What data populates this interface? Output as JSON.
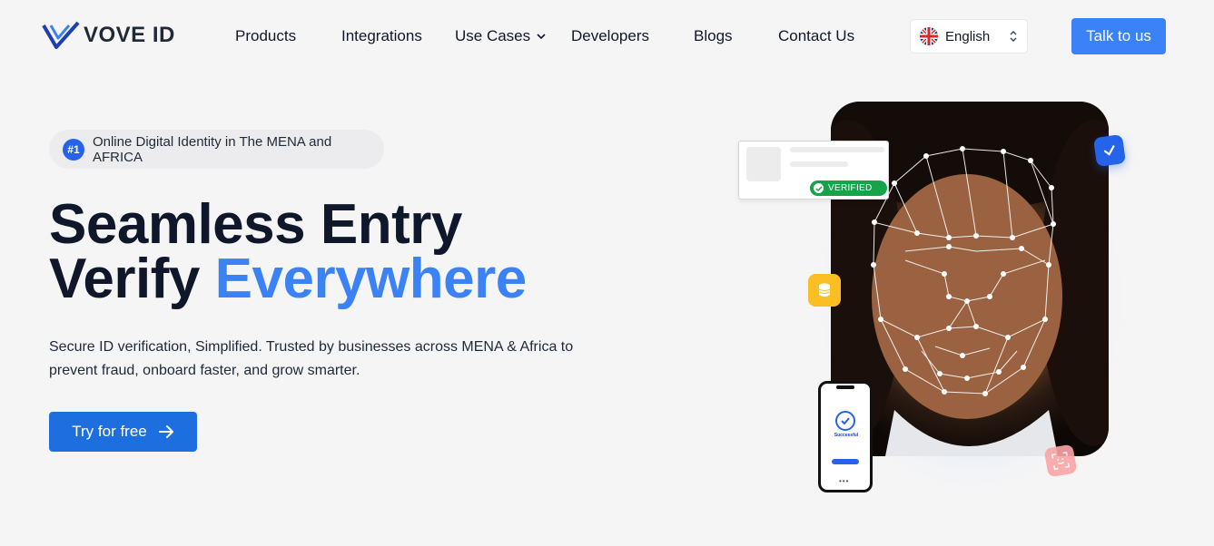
{
  "brand": {
    "name": "VOVE ID",
    "accent": "#3b82f6"
  },
  "nav": {
    "items": [
      {
        "label": "Products"
      },
      {
        "label": "Integrations"
      },
      {
        "label": "Use Cases"
      },
      {
        "label": "Developers"
      },
      {
        "label": "Blogs"
      },
      {
        "label": "Contact Us"
      }
    ],
    "language": "English",
    "cta": "Talk to us"
  },
  "hero": {
    "badge_num": "#1",
    "badge_text": "Online Digital Identity in The MENA and AFRICA",
    "headline_line1": "Seamless Entry",
    "headline_line2_a": "Verify ",
    "headline_line2_b": "Everywhere",
    "subtext": "Secure ID verification, Simplified. Trusted by businesses across MENA & Africa to prevent fraud, onboard faster, and grow smarter.",
    "cta": "Try for free"
  },
  "illustration": {
    "verified_label": "VERIFIED",
    "phone_text": "Successful"
  },
  "icons": [
    "logo-mark-icon",
    "chevron-down-icon",
    "uk-flag-icon",
    "select-arrows-icon",
    "arrow-right-icon",
    "check-icon",
    "database-icon",
    "face-scan-icon"
  ]
}
